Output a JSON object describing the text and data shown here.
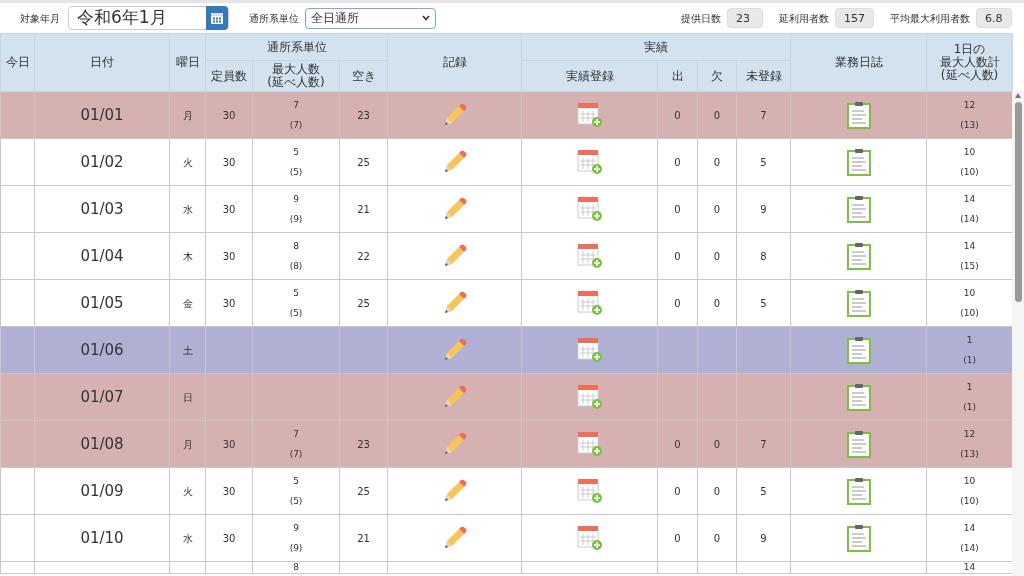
{
  "toolbar": {
    "month_label": "対象年月",
    "month_value": "令和6年1月",
    "unit_label": "通所系単位",
    "unit_value": "全日通所",
    "stats": [
      {
        "label": "提供日数",
        "value": "23"
      },
      {
        "label": "延利用者数",
        "value": "157"
      },
      {
        "label": "平均最大利用者数",
        "value": "6.8"
      }
    ]
  },
  "table": {
    "headers": {
      "today": "今日",
      "date": "日付",
      "weekday": "曜日",
      "unit_group": "通所系単位",
      "capacity": "定員数",
      "max_people": [
        "最大人数",
        "(延べ人数)"
      ],
      "vacancy": "空き",
      "record": "記録",
      "results_group": "実績",
      "results_entry": "実績登録",
      "present": "出",
      "absent": "欠",
      "unregistered": "未登録",
      "journal": "業務日誌",
      "daily_total": [
        "1日の",
        "最大人数計",
        "(延べ人数)"
      ]
    },
    "rows": [
      {
        "kind": "holiday",
        "date": "01/01",
        "weekday": "月",
        "capacity": "30",
        "max": "7",
        "max_sub": "(7)",
        "vacancy": "23",
        "present": "0",
        "absent": "0",
        "unregistered": "7",
        "total": "12",
        "total_sub": "(13)"
      },
      {
        "kind": "weekday",
        "date": "01/02",
        "weekday": "火",
        "capacity": "30",
        "max": "5",
        "max_sub": "(5)",
        "vacancy": "25",
        "present": "0",
        "absent": "0",
        "unregistered": "5",
        "total": "10",
        "total_sub": "(10)"
      },
      {
        "kind": "weekday",
        "date": "01/03",
        "weekday": "水",
        "capacity": "30",
        "max": "9",
        "max_sub": "(9)",
        "vacancy": "21",
        "present": "0",
        "absent": "0",
        "unregistered": "9",
        "total": "14",
        "total_sub": "(14)"
      },
      {
        "kind": "weekday",
        "date": "01/04",
        "weekday": "木",
        "capacity": "30",
        "max": "8",
        "max_sub": "(8)",
        "vacancy": "22",
        "present": "0",
        "absent": "0",
        "unregistered": "8",
        "total": "14",
        "total_sub": "(15)"
      },
      {
        "kind": "weekday",
        "date": "01/05",
        "weekday": "金",
        "capacity": "30",
        "max": "5",
        "max_sub": "(5)",
        "vacancy": "25",
        "present": "0",
        "absent": "0",
        "unregistered": "5",
        "total": "10",
        "total_sub": "(10)"
      },
      {
        "kind": "saturday",
        "date": "01/06",
        "weekday": "土",
        "total": "1",
        "total_sub": "(1)"
      },
      {
        "kind": "holiday",
        "date": "01/07",
        "weekday": "日",
        "total": "1",
        "total_sub": "(1)"
      },
      {
        "kind": "holiday",
        "date": "01/08",
        "weekday": "月",
        "capacity": "30",
        "max": "7",
        "max_sub": "(7)",
        "vacancy": "23",
        "present": "0",
        "absent": "0",
        "unregistered": "7",
        "total": "12",
        "total_sub": "(13)"
      },
      {
        "kind": "weekday",
        "date": "01/09",
        "weekday": "火",
        "capacity": "30",
        "max": "5",
        "max_sub": "(5)",
        "vacancy": "25",
        "present": "0",
        "absent": "0",
        "unregistered": "5",
        "total": "10",
        "total_sub": "(10)"
      },
      {
        "kind": "weekday",
        "date": "01/10",
        "weekday": "水",
        "capacity": "30",
        "max": "9",
        "max_sub": "(9)",
        "vacancy": "21",
        "present": "0",
        "absent": "0",
        "unregistered": "9",
        "total": "14",
        "total_sub": "(14)"
      },
      {
        "kind": "weekday",
        "max": "8",
        "total": "14"
      }
    ]
  }
}
